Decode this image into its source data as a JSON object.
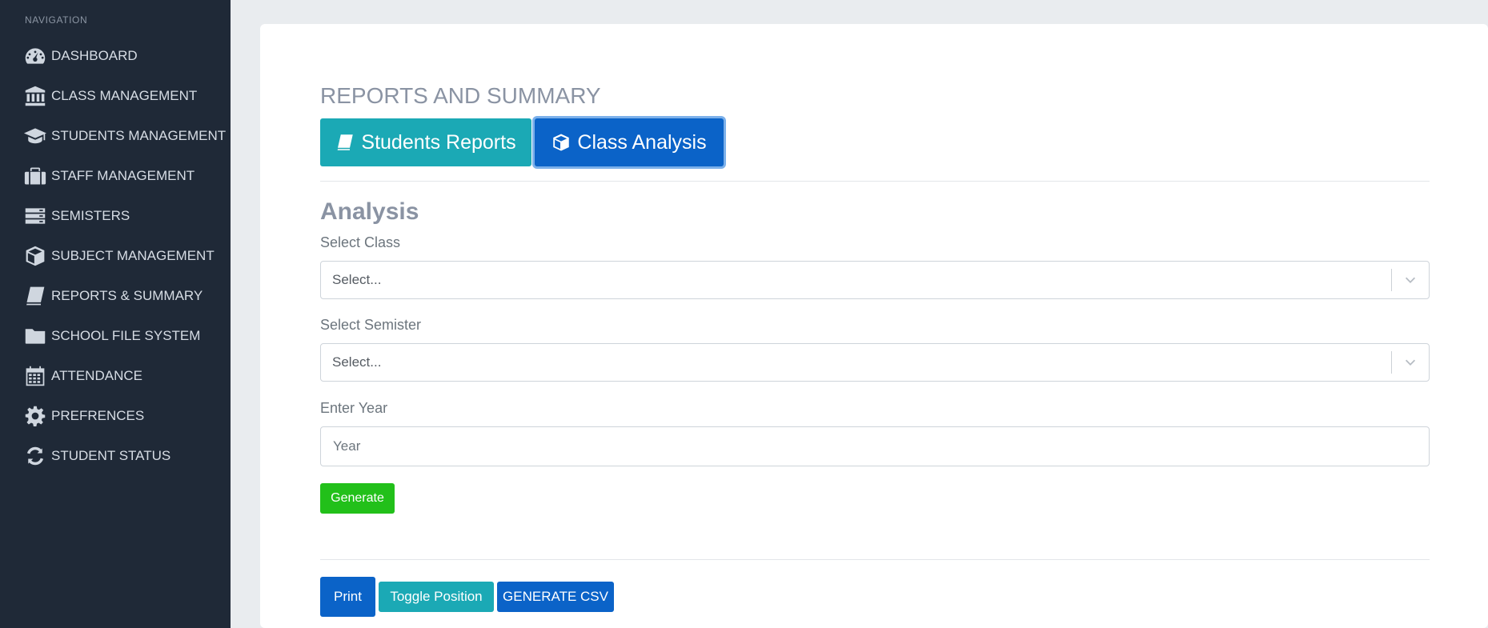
{
  "sidebar": {
    "header": "NAVIGATION",
    "items": [
      {
        "label": "DASHBOARD",
        "icon": "dashboard-icon"
      },
      {
        "label": "CLASS MANAGEMENT",
        "icon": "institution-icon"
      },
      {
        "label": "STUDENTS MANAGEMENT",
        "icon": "graduation-cap-icon"
      },
      {
        "label": "STAFF MANAGEMENT",
        "icon": "suitcase-icon"
      },
      {
        "label": "SEMISTERS",
        "icon": "server-icon"
      },
      {
        "label": "SUBJECT MANAGEMENT",
        "icon": "cube-icon"
      },
      {
        "label": "REPORTS & SUMMARY",
        "icon": "book-icon"
      },
      {
        "label": "SCHOOL FILE SYSTEM",
        "icon": "folder-icon"
      },
      {
        "label": "ATTENDANCE",
        "icon": "calendar-icon"
      },
      {
        "label": "PREFRENCES",
        "icon": "gear-icon"
      },
      {
        "label": "STUDENT STATUS",
        "icon": "refresh-icon"
      }
    ]
  },
  "main": {
    "title": "REPORTS AND SUMMARY",
    "tabs": {
      "students_reports": "Students Reports",
      "class_analysis": "Class Analysis"
    },
    "section_title": "Analysis",
    "select_class": {
      "label": "Select Class",
      "placeholder": "Select..."
    },
    "select_semister": {
      "label": "Select Semister",
      "placeholder": "Select..."
    },
    "year": {
      "label": "Enter Year",
      "placeholder": "Year"
    },
    "generate_label": "Generate",
    "print_label": "Print",
    "toggle_label": "Toggle Position",
    "csv_label": "GENERATE CSV"
  },
  "colors": {
    "sidebar_bg": "#1f2937",
    "teal": "#1ba9b5",
    "blue": "#0b63c8",
    "green": "#22c01a"
  }
}
